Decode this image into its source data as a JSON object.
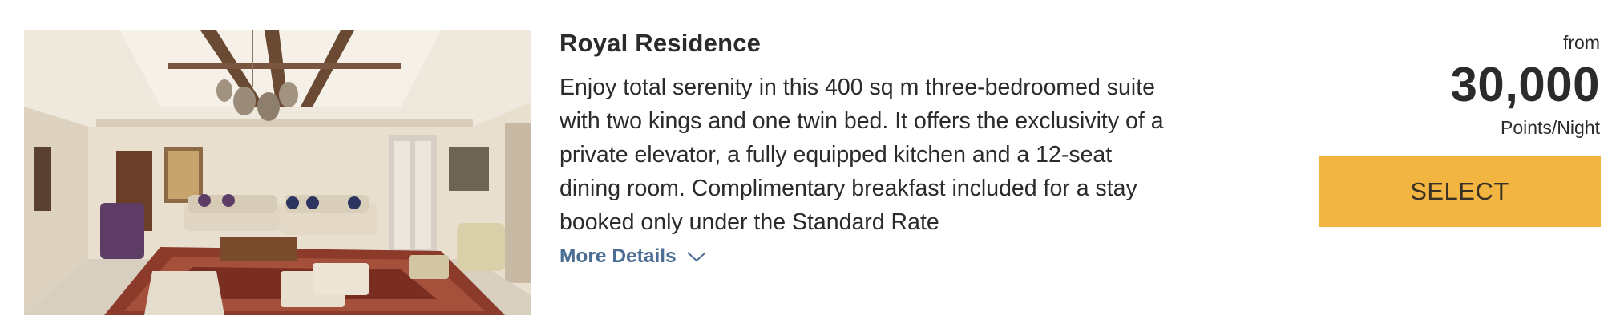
{
  "room": {
    "title": "Royal Residence",
    "description": "Enjoy total serenity in this 400 sq m three-bedroomed suite with two kings and one twin bed. It offers the exclusivity of a private elevator, a fully equipped kitchen and a 12-seat dining room. Complimentary breakfast included for a stay booked only under the Standard Rate",
    "more_details_label": "More Details",
    "more_details_icon": "chevron-down-icon"
  },
  "price": {
    "prefix": "from",
    "amount": "30,000",
    "unit": "Points/Night"
  },
  "actions": {
    "select_label": "SELECT"
  },
  "colors": {
    "select_button": "#f2b541",
    "link": "#4a6e94",
    "text": "#2b2b2b"
  }
}
